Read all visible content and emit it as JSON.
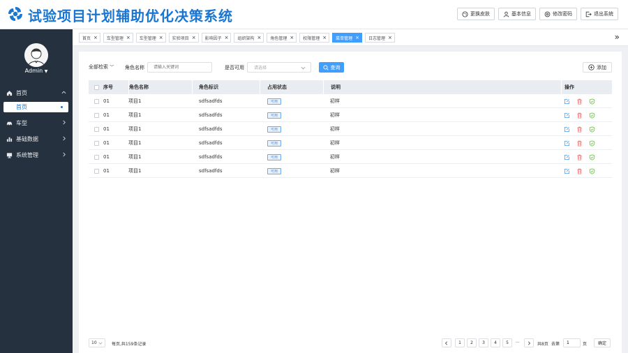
{
  "header": {
    "title": "试验项目计划辅助优化决策系统",
    "actions": [
      {
        "label": "更换皮肤",
        "icon": "palette-icon"
      },
      {
        "label": "基本信息",
        "icon": "user-icon"
      },
      {
        "label": "修改密码",
        "icon": "settings-icon"
      },
      {
        "label": "退出系统",
        "icon": "logout-icon"
      }
    ]
  },
  "sidebar": {
    "user": "Admin",
    "menu": [
      {
        "label": "首页",
        "icon": "home-icon",
        "expanded": true,
        "children": [
          {
            "label": "首页",
            "active": true
          }
        ]
      },
      {
        "label": "车型",
        "icon": "car-icon",
        "expanded": false
      },
      {
        "label": "基础数据",
        "icon": "bar-chart-icon",
        "expanded": false
      },
      {
        "label": "系统管理",
        "icon": "monitor-icon",
        "expanded": false
      }
    ]
  },
  "tabs": [
    {
      "label": "首页",
      "active": false
    },
    {
      "label": "车型管理",
      "active": false
    },
    {
      "label": "车型管理",
      "active": false
    },
    {
      "label": "实验项目",
      "active": false
    },
    {
      "label": "影响因子",
      "active": false
    },
    {
      "label": "组织架构",
      "active": false
    },
    {
      "label": "角色管理",
      "active": false
    },
    {
      "label": "权限管理",
      "active": false
    },
    {
      "label": "菜单管理",
      "active": true
    },
    {
      "label": "日志管理",
      "active": false
    }
  ],
  "tabs_more": "»",
  "filters": {
    "all_search": "全部检索",
    "role_name_label": "角色名称",
    "role_name_placeholder": "请输入关键词",
    "available_label": "是否可用",
    "available_placeholder": "请选择",
    "query_label": "查询",
    "add_label": "添加"
  },
  "table": {
    "columns": [
      "序号",
      "角色名称",
      "角色标识",
      "占用状态",
      "说明",
      "操作"
    ],
    "rows": [
      {
        "index": "01",
        "name": "项目1",
        "key": "sdfsadfds",
        "status": "可用",
        "desc": "初样"
      },
      {
        "index": "01",
        "name": "项目1",
        "key": "sdfsadfds",
        "status": "可用",
        "desc": "初样"
      },
      {
        "index": "01",
        "name": "项目1",
        "key": "sdfsadfds",
        "status": "可用",
        "desc": "初样"
      },
      {
        "index": "01",
        "name": "项目1",
        "key": "sdfsadfds",
        "status": "可用",
        "desc": "初样"
      },
      {
        "index": "01",
        "name": "项目1",
        "key": "sdfsadfds",
        "status": "可用",
        "desc": "初样"
      },
      {
        "index": "01",
        "name": "项目1",
        "key": "sdfsadfds",
        "status": "可用",
        "desc": "初样"
      }
    ],
    "ops": [
      "edit-icon",
      "delete-icon",
      "shield-check-icon"
    ]
  },
  "pagination": {
    "page_size": "10",
    "total_text": "每页,共159条记录",
    "pages": [
      "1",
      "2",
      "3",
      "4",
      "5"
    ],
    "ellipsis": "···",
    "total_pages_text": "共8页",
    "goto_label": "去第",
    "goto_value": "1",
    "page_unit": "页",
    "confirm_label": "确定"
  },
  "colors": {
    "primary": "#409eff",
    "title_blue": "#1976d2",
    "sidebar_bg": "#26313f",
    "delete_red": "#f56c6c",
    "success_green": "#67c23a"
  }
}
